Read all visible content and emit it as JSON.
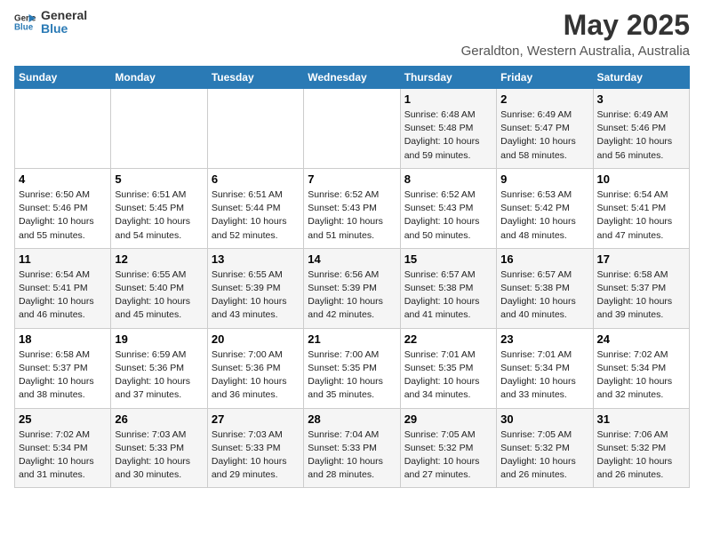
{
  "header": {
    "logo_line1": "General",
    "logo_line2": "Blue",
    "title": "May 2025",
    "subtitle": "Geraldton, Western Australia, Australia"
  },
  "days_of_week": [
    "Sunday",
    "Monday",
    "Tuesday",
    "Wednesday",
    "Thursday",
    "Friday",
    "Saturday"
  ],
  "weeks": [
    [
      {
        "num": "",
        "info": ""
      },
      {
        "num": "",
        "info": ""
      },
      {
        "num": "",
        "info": ""
      },
      {
        "num": "",
        "info": ""
      },
      {
        "num": "1",
        "info": "Sunrise: 6:48 AM\nSunset: 5:48 PM\nDaylight: 10 hours\nand 59 minutes."
      },
      {
        "num": "2",
        "info": "Sunrise: 6:49 AM\nSunset: 5:47 PM\nDaylight: 10 hours\nand 58 minutes."
      },
      {
        "num": "3",
        "info": "Sunrise: 6:49 AM\nSunset: 5:46 PM\nDaylight: 10 hours\nand 56 minutes."
      }
    ],
    [
      {
        "num": "4",
        "info": "Sunrise: 6:50 AM\nSunset: 5:46 PM\nDaylight: 10 hours\nand 55 minutes."
      },
      {
        "num": "5",
        "info": "Sunrise: 6:51 AM\nSunset: 5:45 PM\nDaylight: 10 hours\nand 54 minutes."
      },
      {
        "num": "6",
        "info": "Sunrise: 6:51 AM\nSunset: 5:44 PM\nDaylight: 10 hours\nand 52 minutes."
      },
      {
        "num": "7",
        "info": "Sunrise: 6:52 AM\nSunset: 5:43 PM\nDaylight: 10 hours\nand 51 minutes."
      },
      {
        "num": "8",
        "info": "Sunrise: 6:52 AM\nSunset: 5:43 PM\nDaylight: 10 hours\nand 50 minutes."
      },
      {
        "num": "9",
        "info": "Sunrise: 6:53 AM\nSunset: 5:42 PM\nDaylight: 10 hours\nand 48 minutes."
      },
      {
        "num": "10",
        "info": "Sunrise: 6:54 AM\nSunset: 5:41 PM\nDaylight: 10 hours\nand 47 minutes."
      }
    ],
    [
      {
        "num": "11",
        "info": "Sunrise: 6:54 AM\nSunset: 5:41 PM\nDaylight: 10 hours\nand 46 minutes."
      },
      {
        "num": "12",
        "info": "Sunrise: 6:55 AM\nSunset: 5:40 PM\nDaylight: 10 hours\nand 45 minutes."
      },
      {
        "num": "13",
        "info": "Sunrise: 6:55 AM\nSunset: 5:39 PM\nDaylight: 10 hours\nand 43 minutes."
      },
      {
        "num": "14",
        "info": "Sunrise: 6:56 AM\nSunset: 5:39 PM\nDaylight: 10 hours\nand 42 minutes."
      },
      {
        "num": "15",
        "info": "Sunrise: 6:57 AM\nSunset: 5:38 PM\nDaylight: 10 hours\nand 41 minutes."
      },
      {
        "num": "16",
        "info": "Sunrise: 6:57 AM\nSunset: 5:38 PM\nDaylight: 10 hours\nand 40 minutes."
      },
      {
        "num": "17",
        "info": "Sunrise: 6:58 AM\nSunset: 5:37 PM\nDaylight: 10 hours\nand 39 minutes."
      }
    ],
    [
      {
        "num": "18",
        "info": "Sunrise: 6:58 AM\nSunset: 5:37 PM\nDaylight: 10 hours\nand 38 minutes."
      },
      {
        "num": "19",
        "info": "Sunrise: 6:59 AM\nSunset: 5:36 PM\nDaylight: 10 hours\nand 37 minutes."
      },
      {
        "num": "20",
        "info": "Sunrise: 7:00 AM\nSunset: 5:36 PM\nDaylight: 10 hours\nand 36 minutes."
      },
      {
        "num": "21",
        "info": "Sunrise: 7:00 AM\nSunset: 5:35 PM\nDaylight: 10 hours\nand 35 minutes."
      },
      {
        "num": "22",
        "info": "Sunrise: 7:01 AM\nSunset: 5:35 PM\nDaylight: 10 hours\nand 34 minutes."
      },
      {
        "num": "23",
        "info": "Sunrise: 7:01 AM\nSunset: 5:34 PM\nDaylight: 10 hours\nand 33 minutes."
      },
      {
        "num": "24",
        "info": "Sunrise: 7:02 AM\nSunset: 5:34 PM\nDaylight: 10 hours\nand 32 minutes."
      }
    ],
    [
      {
        "num": "25",
        "info": "Sunrise: 7:02 AM\nSunset: 5:34 PM\nDaylight: 10 hours\nand 31 minutes."
      },
      {
        "num": "26",
        "info": "Sunrise: 7:03 AM\nSunset: 5:33 PM\nDaylight: 10 hours\nand 30 minutes."
      },
      {
        "num": "27",
        "info": "Sunrise: 7:03 AM\nSunset: 5:33 PM\nDaylight: 10 hours\nand 29 minutes."
      },
      {
        "num": "28",
        "info": "Sunrise: 7:04 AM\nSunset: 5:33 PM\nDaylight: 10 hours\nand 28 minutes."
      },
      {
        "num": "29",
        "info": "Sunrise: 7:05 AM\nSunset: 5:32 PM\nDaylight: 10 hours\nand 27 minutes."
      },
      {
        "num": "30",
        "info": "Sunrise: 7:05 AM\nSunset: 5:32 PM\nDaylight: 10 hours\nand 26 minutes."
      },
      {
        "num": "31",
        "info": "Sunrise: 7:06 AM\nSunset: 5:32 PM\nDaylight: 10 hours\nand 26 minutes."
      }
    ]
  ]
}
